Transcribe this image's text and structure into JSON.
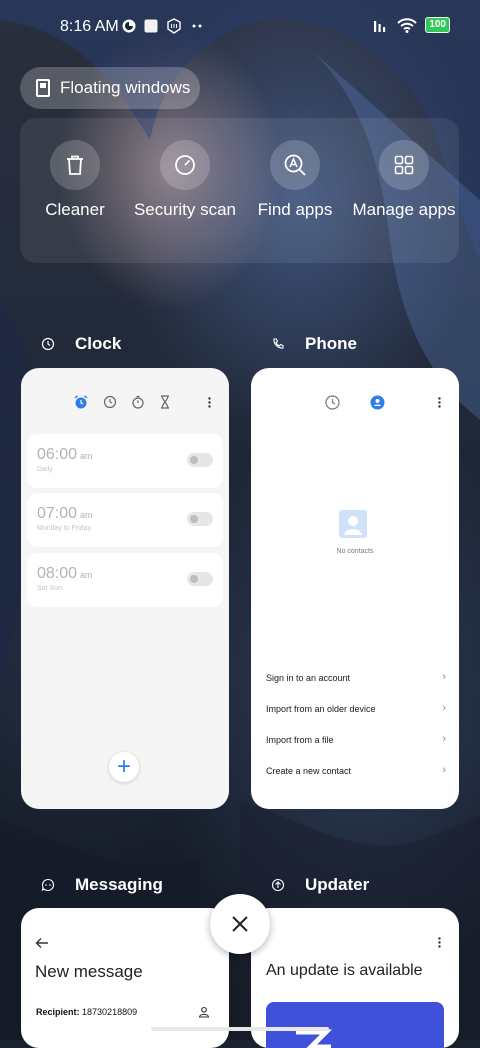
{
  "status_bar": {
    "time": "8:16 AM",
    "battery": "100"
  },
  "floating_windows": {
    "label": "Floating windows"
  },
  "quick_actions": [
    {
      "label": "Cleaner",
      "icon": "trash-icon"
    },
    {
      "label": "Security scan",
      "icon": "shield-scan-icon"
    },
    {
      "label": "Find apps",
      "icon": "find-apps-icon"
    },
    {
      "label": "Manage apps",
      "icon": "grid-icon"
    }
  ],
  "recent_apps": {
    "clock": {
      "title": "Clock",
      "alarms": [
        {
          "time": "06:00",
          "ampm": "am",
          "repeat": "Daily"
        },
        {
          "time": "07:00",
          "ampm": "am",
          "repeat": "Monday to Friday"
        },
        {
          "time": "08:00",
          "ampm": "am",
          "repeat": "Sat Sun"
        }
      ],
      "fab": "+"
    },
    "phone": {
      "title": "Phone",
      "empty_state": "No contacts",
      "options": [
        "Sign in to an account",
        "Import from an older device",
        "Import from a file",
        "Create a new contact"
      ]
    },
    "messaging": {
      "title": "Messaging",
      "heading": "New message",
      "recipient_label": "Recipient:",
      "recipient_value": "18730218809"
    },
    "updater": {
      "title": "Updater",
      "heading": "An update is available"
    }
  },
  "colors": {
    "accent_blue": "#2f7de8",
    "updater_banner": "#3f51d9"
  }
}
